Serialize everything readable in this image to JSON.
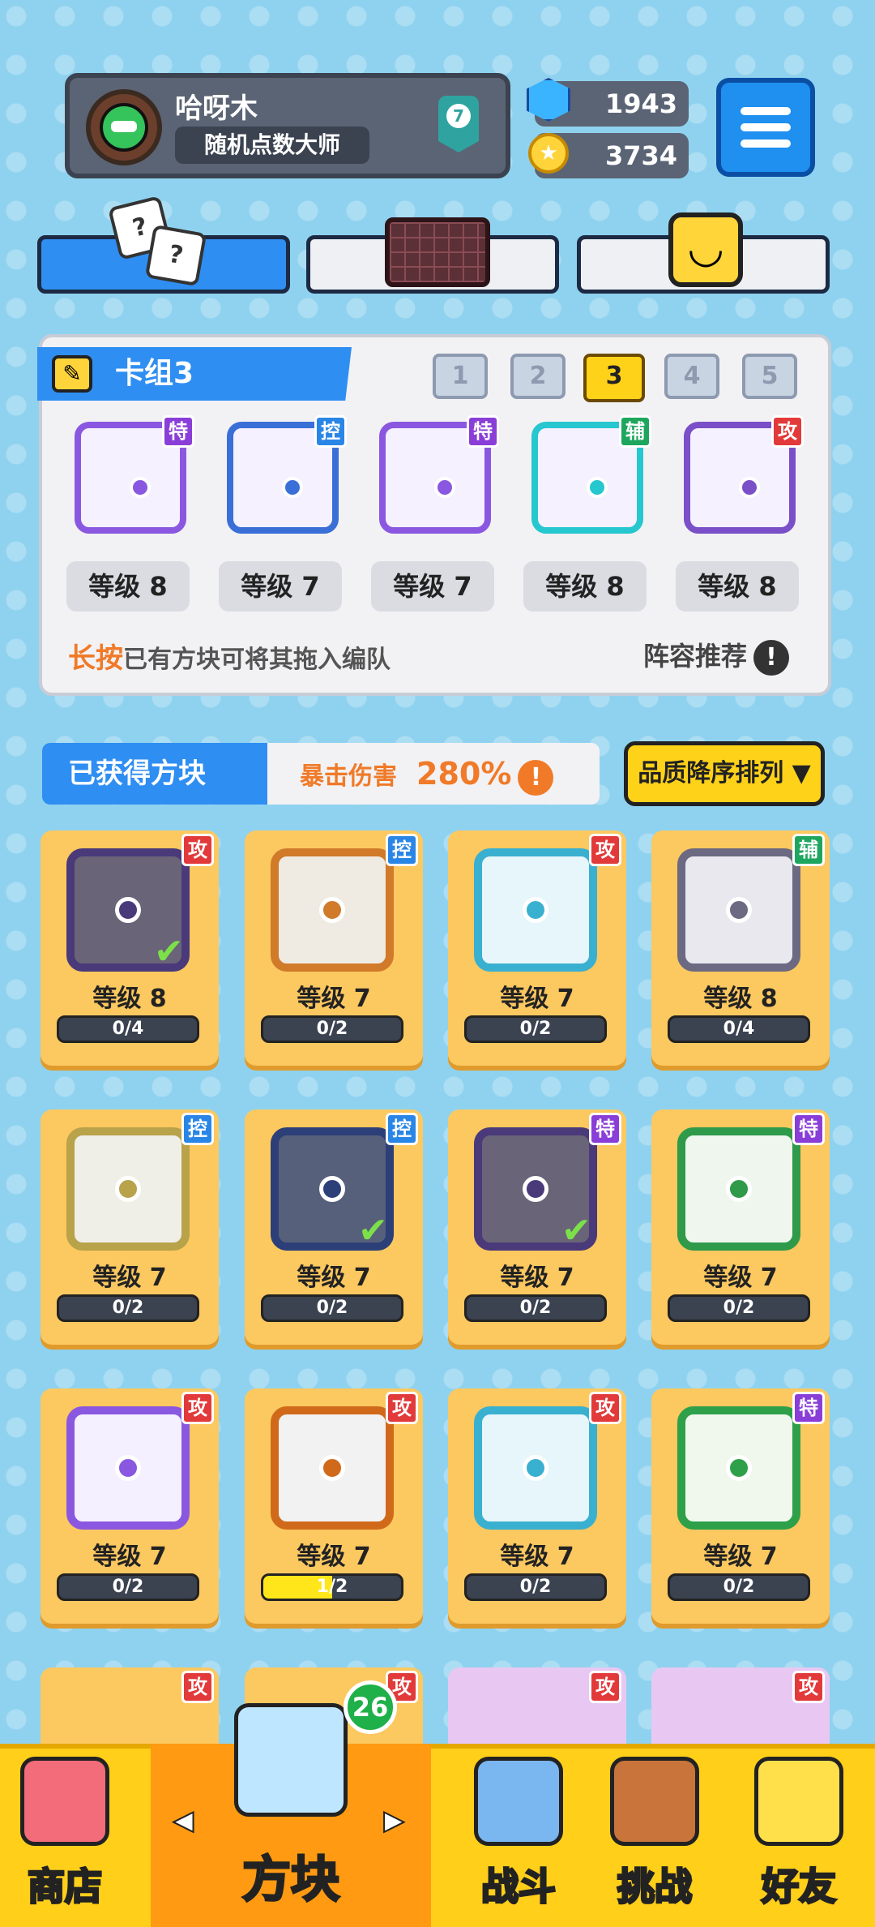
{
  "player": {
    "name": "哈呀木",
    "title": "随机点数大师",
    "rank": "7"
  },
  "currency": {
    "gems": "1943",
    "coins": "3734"
  },
  "deck": {
    "title": "卡组3",
    "tabs": [
      "1",
      "2",
      "3",
      "4",
      "5"
    ],
    "active_tab": "3",
    "cards": [
      {
        "tag": "特",
        "tag_type": "special",
        "level": "等级 8",
        "color": "#8a58e0"
      },
      {
        "tag": "控",
        "tag_type": "control",
        "level": "等级 7",
        "color": "#3a6fd8"
      },
      {
        "tag": "特",
        "tag_type": "special",
        "level": "等级 7",
        "color": "#8a58e0"
      },
      {
        "tag": "辅",
        "tag_type": "support",
        "level": "等级 8",
        "color": "#26c7cf"
      },
      {
        "tag": "攻",
        "tag_type": "attack",
        "level": "等级 8",
        "color": "#7a4fc8"
      }
    ],
    "hint_key": "长按",
    "hint_rest": "已有方块可将其拖入编队",
    "recommend": "阵容推荐",
    "excl": "!"
  },
  "obtained": {
    "title": "已获得方块",
    "crit_label": "暴击伤害",
    "crit_value": "280%",
    "sort_label": "品质降序排列 ▼",
    "cards": [
      {
        "tag": "攻",
        "tag_type": "attack",
        "level": "等级 8",
        "progress": "0/4",
        "fill": 0,
        "color": "#4a3a7a",
        "face": "#6a6478",
        "checked": true
      },
      {
        "tag": "控",
        "tag_type": "control",
        "level": "等级 7",
        "progress": "0/2",
        "fill": 0,
        "color": "#d07a2a",
        "face": "#efeae2",
        "checked": false
      },
      {
        "tag": "攻",
        "tag_type": "attack",
        "level": "等级 7",
        "progress": "0/2",
        "fill": 0,
        "color": "#3ab0d0",
        "face": "#e6f6fa",
        "checked": false
      },
      {
        "tag": "辅",
        "tag_type": "support",
        "level": "等级 8",
        "progress": "0/4",
        "fill": 0,
        "color": "#6c6a82",
        "face": "#e8e8ee",
        "checked": false
      },
      {
        "tag": "控",
        "tag_type": "control",
        "level": "等级 7",
        "progress": "0/2",
        "fill": 0,
        "color": "#b8a24a",
        "face": "#efefe8",
        "checked": false
      },
      {
        "tag": "控",
        "tag_type": "control",
        "level": "等级 7",
        "progress": "0/2",
        "fill": 0,
        "color": "#2c3f78",
        "face": "#56607a",
        "checked": true
      },
      {
        "tag": "特",
        "tag_type": "special",
        "level": "等级 7",
        "progress": "0/2",
        "fill": 0,
        "color": "#4a3a7a",
        "face": "#6a6478",
        "checked": true
      },
      {
        "tag": "特",
        "tag_type": "special",
        "level": "等级 7",
        "progress": "0/2",
        "fill": 0,
        "color": "#2f9a4a",
        "face": "#eef6ee",
        "checked": false
      },
      {
        "tag": "攻",
        "tag_type": "attack",
        "level": "等级 7",
        "progress": "0/2",
        "fill": 0,
        "color": "#8a58e0",
        "face": "#f5f0ff",
        "checked": false
      },
      {
        "tag": "攻",
        "tag_type": "attack",
        "level": "等级 7",
        "progress": "1/2",
        "fill": 0.5,
        "color": "#d06a1a",
        "face": "#f2f2f2",
        "checked": false
      },
      {
        "tag": "攻",
        "tag_type": "attack",
        "level": "等级 7",
        "progress": "0/2",
        "fill": 0,
        "color": "#3ab0d0",
        "face": "#e6f6fa",
        "checked": false
      },
      {
        "tag": "特",
        "tag_type": "special",
        "level": "等级 7",
        "progress": "0/2",
        "fill": 0,
        "color": "#2fa04a",
        "face": "#f0f8ee",
        "checked": false
      }
    ],
    "partial_tags": [
      "攻",
      "攻",
      "攻",
      "攻"
    ]
  },
  "nav": {
    "shop": "商店",
    "blocks": "方块",
    "battle": "战斗",
    "challenge": "挑战",
    "friends": "好友",
    "blocks_badge": "26",
    "left_arrow": "◀",
    "right_arrow": "▶"
  },
  "colors": {
    "accent": "#2f8ef2",
    "nav": "#ffcf1a",
    "card": "#fcc860"
  }
}
